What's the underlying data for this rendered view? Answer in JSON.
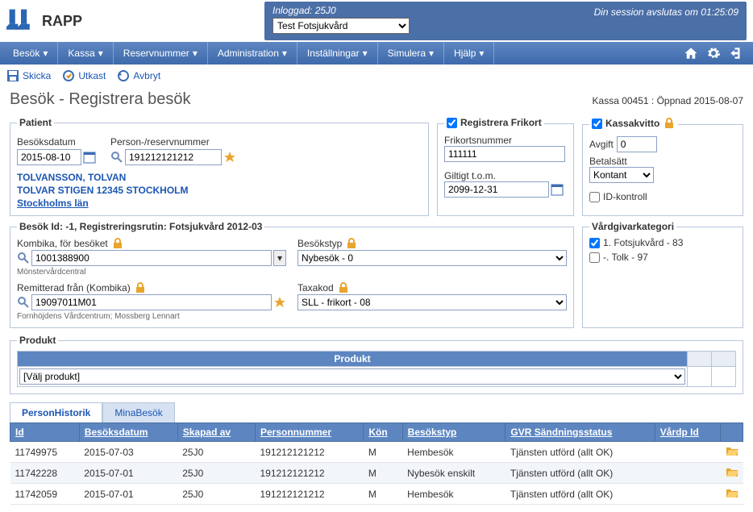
{
  "app": {
    "name": "RAPP"
  },
  "session": {
    "loginLabel": "Inloggad: 25J0",
    "unitSelected": "Test Fotsjukvård",
    "expires": "Din session avslutas om 01:25:09"
  },
  "nav": {
    "items": [
      "Besök",
      "Kassa",
      "Reservnummer",
      "Administration",
      "Inställningar",
      "Simulera",
      "Hjälp"
    ]
  },
  "toolbar": {
    "skicka": "Skicka",
    "utkast": "Utkast",
    "avbryt": "Avbryt"
  },
  "page": {
    "title": "Besök - Registrera besök",
    "kassaStatus": "Kassa 00451 : Öppnad 2015-08-07"
  },
  "patient": {
    "legend": "Patient",
    "besoksdatumLabel": "Besöksdatum",
    "besoksdatum": "2015-08-10",
    "pnrLabel": "Person-/reservnummer",
    "pnr": "191212121212",
    "name": "TOLVANSSON, TOLVAN",
    "addr": "TOLVAR STIGEN  12345  STOCKHOLM",
    "lan": "Stockholms län"
  },
  "frikort": {
    "registerLabel": "Registrera Frikort",
    "registerChecked": true,
    "nummerLabel": "Frikortsnummer",
    "nummer": "111111",
    "giltLabel": "Giltigt t.o.m.",
    "giltValue": "2099-12-31"
  },
  "kvitto": {
    "label": "Kassakvitto",
    "checked": true,
    "avgiftLabel": "Avgift",
    "avgift": "0",
    "betalLabel": "Betalsätt",
    "betalValue": "Kontant",
    "idkontrollLabel": "ID-kontroll",
    "idkontroll": false
  },
  "besok": {
    "legend": "Besök  Id: -1, Registreringsrutin: Fotsjukvård 2012-03",
    "kombikaLabel": "Kombika, för besöket",
    "kombika": "1001388900",
    "kombikaNote": "Mönstervårdcentral",
    "bestypLabel": "Besökstyp",
    "bestyp": "Nybesök - 0",
    "remLabel": "Remitterad från (Kombika)",
    "remValue": "19097011M01",
    "remNote": "Fornhöjdens Vårdcentrum; Mossberg Lennart",
    "taxaLabel": "Taxakod",
    "taxa": "SLL - frikort - 08"
  },
  "vard": {
    "legend": "Vårdgivarkategori",
    "opt1": "1. Fotsjukvård - 83",
    "opt1checked": true,
    "opt2": "-. Tolk - 97",
    "opt2checked": false
  },
  "produkt": {
    "legend": "Produkt",
    "header": "Produkt",
    "placeholder": "[Välj produkt]"
  },
  "tabs": {
    "person": "PersonHistorik",
    "mina": "MinaBesök"
  },
  "table": {
    "cols": [
      "Id",
      "Besöksdatum",
      "Skapad av",
      "Personnummer",
      "Kön",
      "Besökstyp",
      "GVR Sändningsstatus",
      "Vårdp Id",
      ""
    ],
    "rows": [
      {
        "id": "11749975",
        "date": "2015-07-03",
        "by": "25J0",
        "pnr": "191212121212",
        "kon": "M",
        "typ": "Hembesök",
        "status": "Tjänsten utförd (allt OK)",
        "vard": ""
      },
      {
        "id": "11742228",
        "date": "2015-07-01",
        "by": "25J0",
        "pnr": "191212121212",
        "kon": "M",
        "typ": "Nybesök enskilt",
        "status": "Tjänsten utförd (allt OK)",
        "vard": ""
      },
      {
        "id": "11742059",
        "date": "2015-07-01",
        "by": "25J0",
        "pnr": "191212121212",
        "kon": "M",
        "typ": "Hembesök",
        "status": "Tjänsten utförd (allt OK)",
        "vard": ""
      }
    ]
  }
}
